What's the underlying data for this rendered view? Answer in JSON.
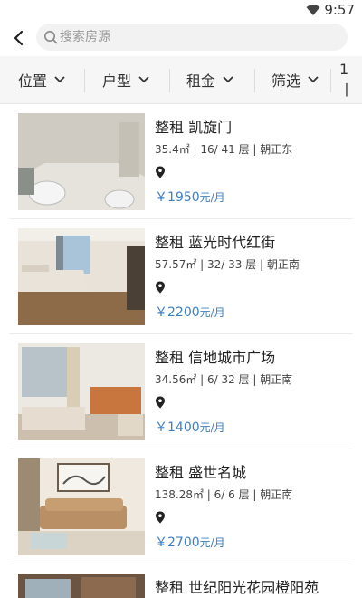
{
  "status_bar": {
    "time": "9:57"
  },
  "header": {
    "search_placeholder": "搜索房源"
  },
  "filters": [
    {
      "label": "位置"
    },
    {
      "label": "户型"
    },
    {
      "label": "租金"
    },
    {
      "label": "筛选"
    },
    {
      "label": "1丨"
    }
  ],
  "listings": [
    {
      "title": "整租 凯旋门",
      "details": "35.4㎡ | 16/ 41 层 | 朝正东",
      "price": "￥1950",
      "unit": "元/月"
    },
    {
      "title": "整租 蓝光时代红街",
      "details": "57.57㎡ | 32/ 33 层 | 朝正南",
      "price": "￥2200",
      "unit": "元/月"
    },
    {
      "title": "整租 信地城市广场",
      "details": "34.56㎡ | 6/ 32 层 | 朝正南",
      "price": "￥1400",
      "unit": "元/月"
    },
    {
      "title": "整租 盛世名城",
      "details": "138.28㎡ | 6/ 6 层 | 朝正南",
      "price": "￥2700",
      "unit": "元/月"
    },
    {
      "title": "整租 世纪阳光花园橙阳苑",
      "details": "",
      "price": "",
      "unit": ""
    }
  ],
  "colors": {
    "price": "#3b7fc4",
    "filter_bg": "#f6f6f6",
    "search_bg": "#f2f2f2"
  }
}
